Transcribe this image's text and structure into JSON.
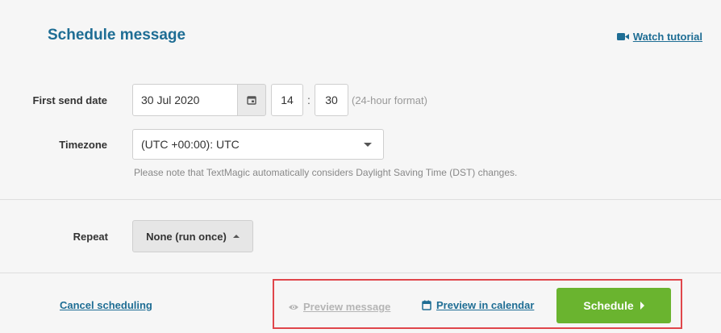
{
  "header": {
    "title": "Schedule message",
    "watch_tutorial": "Watch tutorial"
  },
  "first_send": {
    "label": "First send date",
    "date": "30 Jul 2020",
    "hour": "14",
    "separator": ":",
    "minute": "30",
    "hint": "(24-hour format)"
  },
  "timezone": {
    "label": "Timezone",
    "value": "(UTC +00:00): UTC",
    "note": "Please note that TextMagic automatically considers Daylight Saving Time (DST) changes."
  },
  "repeat": {
    "label": "Repeat",
    "value": "None (run once)"
  },
  "footer": {
    "cancel": "Cancel scheduling",
    "preview_message": "Preview message",
    "preview_calendar": "Preview in calendar",
    "schedule": "Schedule"
  },
  "colors": {
    "accent": "#1e6d94",
    "primary_button": "#6ab42f",
    "highlight_border": "#e0464b"
  },
  "icons": {
    "tutorial": "video-camera-icon",
    "date_picker": "calendar-icon",
    "preview_message": "eye-icon",
    "preview_calendar": "calendar-icon",
    "schedule": "caret-right-icon"
  }
}
